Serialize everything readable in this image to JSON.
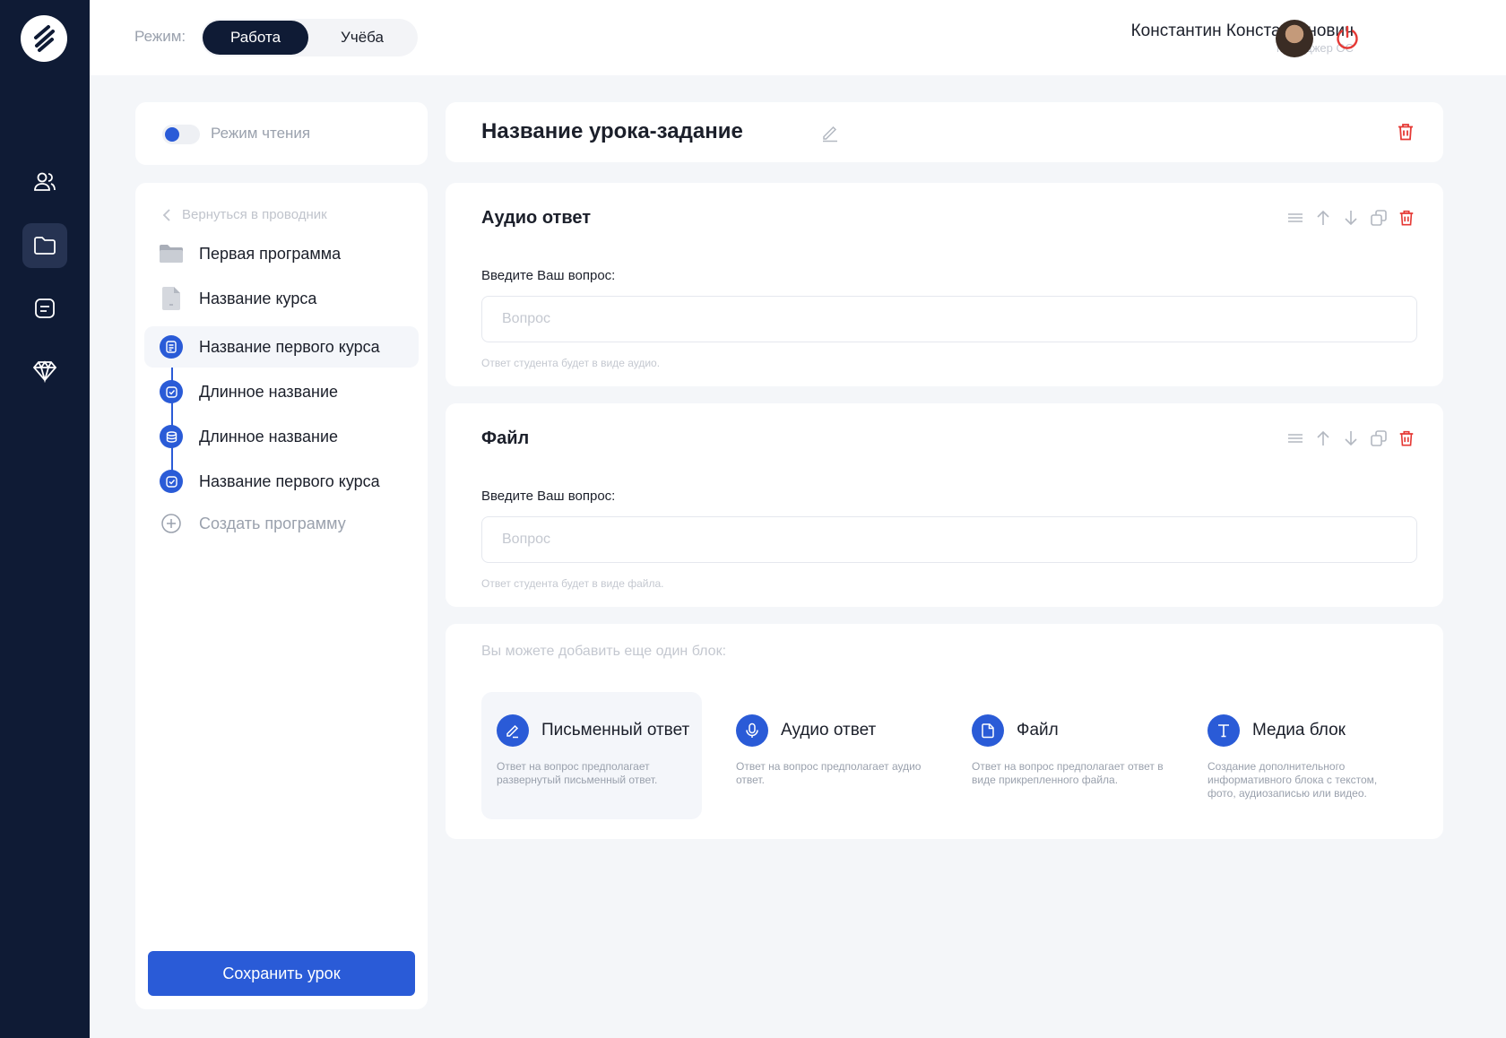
{
  "header": {
    "mode_label": "Режим:",
    "modes": [
      "Работа",
      "Учёба"
    ],
    "user_name": "Константин Константинович",
    "user_role": "Менеджер ОС"
  },
  "colors": {
    "accent": "#2a5bd7",
    "rail": "#0f1b35",
    "danger": "#e53935"
  },
  "sidebar_nav": {
    "icons": [
      "users-icon",
      "folder-icon",
      "document-list-icon",
      "diamond-icon"
    ],
    "active": "folder-icon"
  },
  "reading_mode": {
    "label": "Режим чтения"
  },
  "tree": {
    "back_label": "Вернуться в проводник",
    "program": "Первая программа",
    "course": "Название курса",
    "lessons": [
      "Название первого курса",
      "Длинное название",
      "Длинное название",
      "Название первого курса"
    ],
    "create_label": "Создать программу",
    "save_label": "Сохранить урок"
  },
  "lesson": {
    "title": "Название урока-задание"
  },
  "blocks": [
    {
      "title": "Аудио ответ",
      "field_label": "Введите Ваш вопрос:",
      "placeholder": "Вопрос",
      "hint": "Ответ студента будет в виде аудио."
    },
    {
      "title": "Файл",
      "field_label": "Введите Ваш вопрос:",
      "placeholder": "Вопрос",
      "hint": "Ответ студента будет в виде  файла."
    }
  ],
  "add_block": {
    "title": "Вы можете добавить еще один блок:",
    "options": [
      {
        "title": "Письменный ответ",
        "desc": "Ответ на вопрос предполагает развернутый письменный ответ."
      },
      {
        "title": "Аудио ответ",
        "desc": "Ответ на вопрос предполагает аудио ответ."
      },
      {
        "title": "Файл",
        "desc": "Ответ на вопрос предполагает ответ в виде прикрепленного файла."
      },
      {
        "title": "Медиа блок",
        "desc": "Создание дополнительного информативного блока с текстом, фото, аудиозаписью или видео."
      }
    ]
  }
}
